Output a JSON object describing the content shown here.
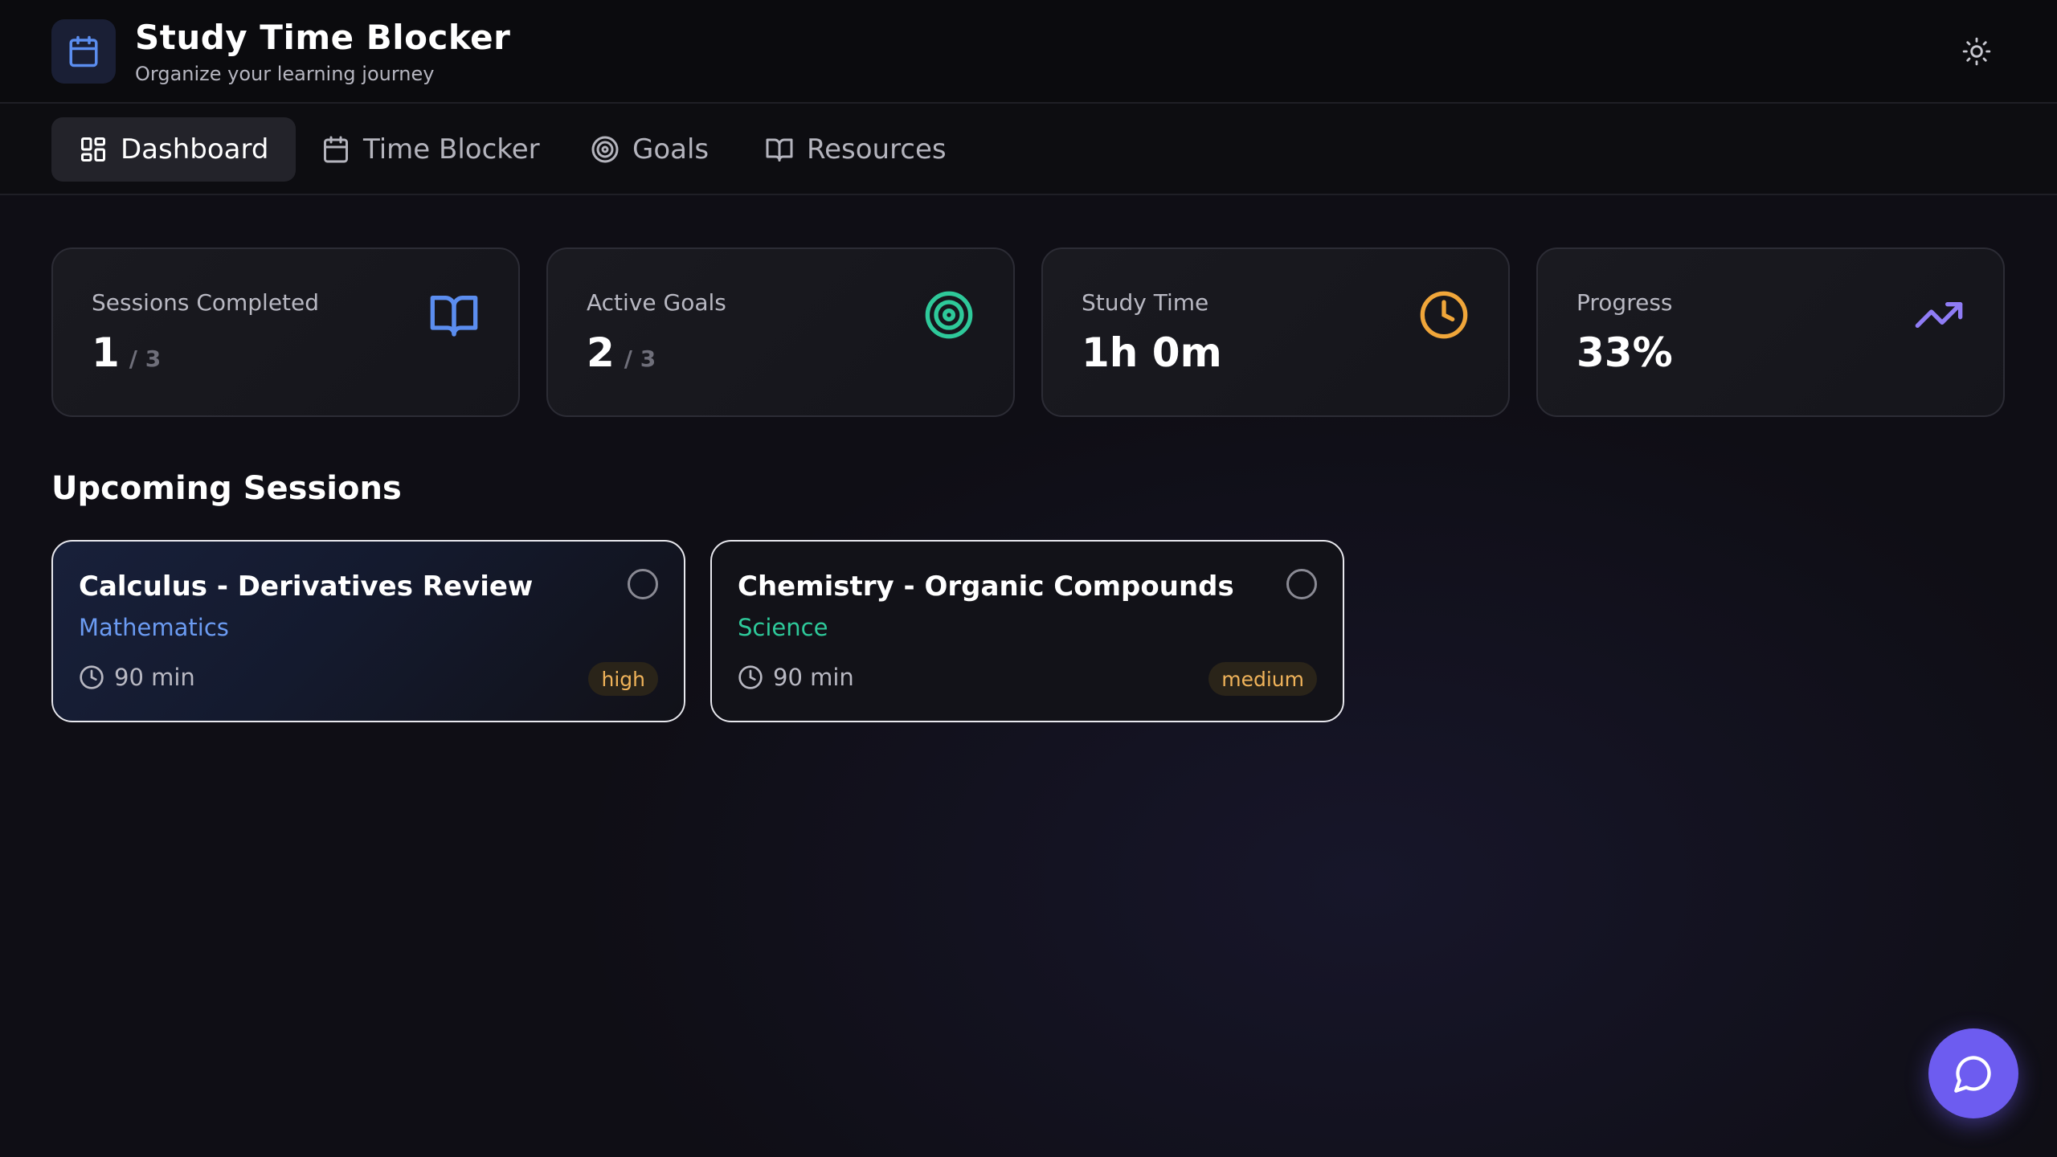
{
  "app": {
    "title": "Study Time Blocker",
    "subtitle": "Organize your learning journey"
  },
  "nav": {
    "items": [
      {
        "label": "Dashboard",
        "icon": "dashboard-icon",
        "active": true
      },
      {
        "label": "Time Blocker",
        "icon": "calendar-icon",
        "active": false
      },
      {
        "label": "Goals",
        "icon": "target-icon",
        "active": false
      },
      {
        "label": "Resources",
        "icon": "book-open-icon",
        "active": false
      }
    ]
  },
  "stats": [
    {
      "label": "Sessions Completed",
      "value": "1",
      "sub": "/ 3",
      "icon": "book-open-icon",
      "color": "#5b8def"
    },
    {
      "label": "Active Goals",
      "value": "2",
      "sub": "/ 3",
      "icon": "target-icon",
      "color": "#2ec99a"
    },
    {
      "label": "Study Time",
      "value": "1h 0m",
      "sub": "",
      "icon": "clock-icon",
      "color": "#f0a63a"
    },
    {
      "label": "Progress",
      "value": "33%",
      "sub": "",
      "icon": "trending-up-icon",
      "color": "#8f7cf5"
    }
  ],
  "sections": {
    "upcoming_title": "Upcoming Sessions"
  },
  "sessions": [
    {
      "title": "Calculus - Derivatives Review",
      "subject": "Mathematics",
      "subject_color": "#6b9bf2",
      "duration": "90 min",
      "priority": "high",
      "completed": false
    },
    {
      "title": "Chemistry - Organic Compounds",
      "subject": "Science",
      "subject_color": "#2ec99a",
      "duration": "90 min",
      "priority": "medium",
      "completed": false
    }
  ],
  "colors": {
    "accent": "#6d5cf0",
    "background": "#0f0e15",
    "priority_text": "#f0b35a"
  }
}
